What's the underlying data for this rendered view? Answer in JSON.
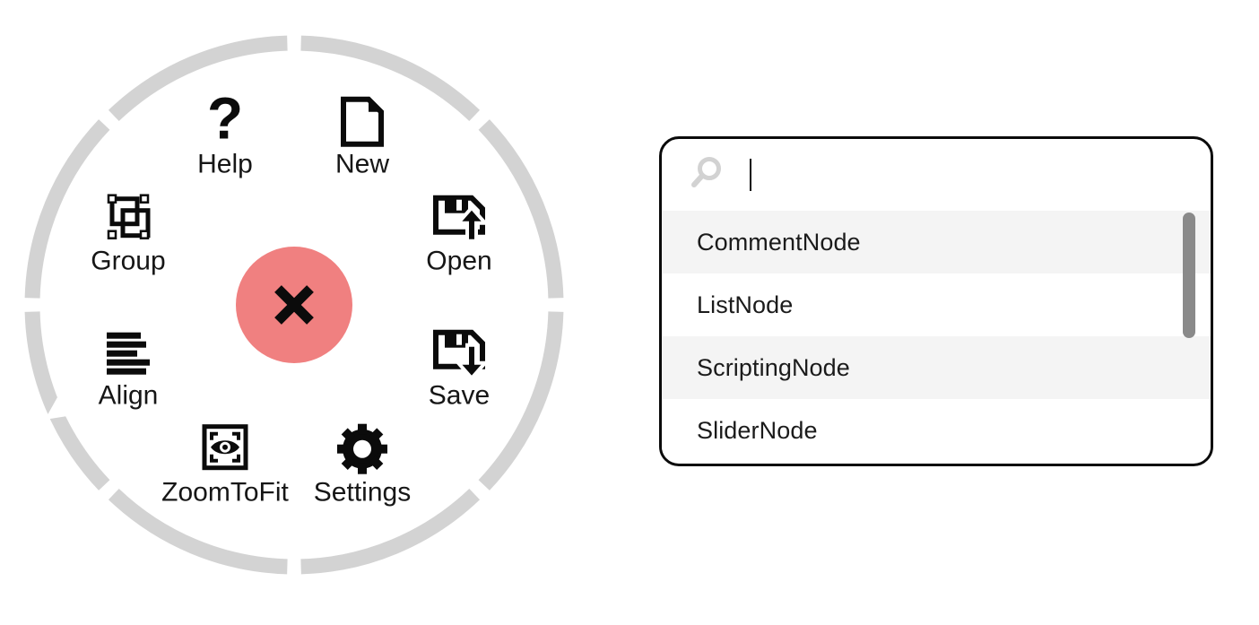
{
  "radial_menu": {
    "name": "radial-pie-menu",
    "center_button": {
      "label": "Close",
      "icon": "close-x-icon",
      "color": "#F08080"
    },
    "ring": {
      "color": "#D3D3D3",
      "segments": 8,
      "notch": "selection-pointer-triangle"
    },
    "items": [
      {
        "id": "help",
        "label": "Help",
        "icon": "question-mark-icon"
      },
      {
        "id": "new",
        "label": "New",
        "icon": "new-document-icon"
      },
      {
        "id": "open",
        "label": "Open",
        "icon": "floppy-disk-up-arrow-icon"
      },
      {
        "id": "save",
        "label": "Save",
        "icon": "floppy-disk-down-arrow-icon"
      },
      {
        "id": "settings",
        "label": "Settings",
        "icon": "gear-icon"
      },
      {
        "id": "zoomtofit",
        "label": "ZoomToFit",
        "icon": "eye-crop-frame-icon"
      },
      {
        "id": "align",
        "label": "Align",
        "icon": "align-left-bars-icon"
      },
      {
        "id": "group",
        "label": "Group",
        "icon": "group-squares-icon"
      }
    ]
  },
  "search_panel": {
    "name": "node-search-popup",
    "search": {
      "icon": "search-magnifier-icon",
      "value": "",
      "placeholder": ""
    },
    "results": [
      {
        "label": "CommentNode",
        "striped": true
      },
      {
        "label": "ListNode",
        "striped": false
      },
      {
        "label": "ScriptingNode",
        "striped": true
      },
      {
        "label": "SliderNode",
        "striped": false
      }
    ],
    "scrollbar": {
      "name": "results-scrollbar"
    },
    "colors": {
      "stripe": "#F4F4F4",
      "border": "#0b0b0b",
      "scroll_thumb": "#8a8a8a"
    }
  }
}
